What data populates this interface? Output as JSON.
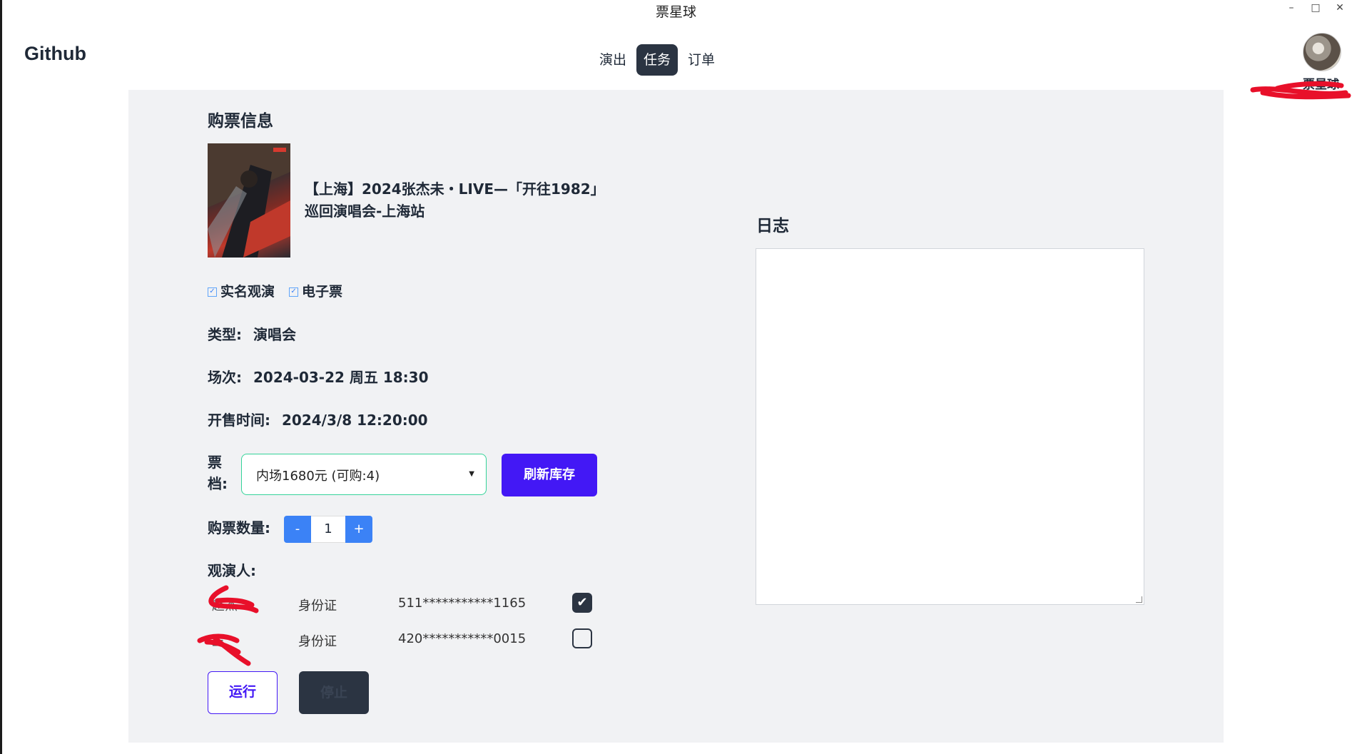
{
  "window": {
    "title": "票星球",
    "controls": {
      "minimize": "–",
      "maximize": "□",
      "close": "✕"
    }
  },
  "header": {
    "brand": "Github",
    "tabs": [
      {
        "label": "演出"
      },
      {
        "label": "任务"
      },
      {
        "label": "订单"
      }
    ],
    "active_tab": "任务",
    "user": {
      "name": "票星球"
    }
  },
  "ticket": {
    "section_title": "购票信息",
    "show_title_line1": "【上海】2024张杰未・LIVE—「开往1982」",
    "show_title_line2": "巡回演唱会-上海站",
    "tags": [
      "实名观演",
      "电子票"
    ],
    "type_label": "类型:",
    "type_value": "演唱会",
    "session_label": "场次:",
    "session_value": "2024-03-22 周五 18:30",
    "sale_label": "开售时间:",
    "sale_value": "2024/3/8 12:20:00",
    "tier_label": "票档:",
    "tier_selected": "内场1680元 (可购:4)",
    "refresh_label": "刷新库存",
    "qty_label": "购票数量:",
    "qty_minus": "-",
    "qty_value": "1",
    "qty_plus": "+",
    "audience_label": "观演人:",
    "audience": [
      {
        "name": "赵杰",
        "id_type": "身份证",
        "id_number": "511***********1165",
        "checked": true
      },
      {
        "name": "王",
        "id_type": "身份证",
        "id_number": "420***********0015",
        "checked": false
      }
    ],
    "run_label": "运行",
    "stop_label": "停止"
  },
  "log": {
    "title": "日志",
    "content": ""
  },
  "colors": {
    "accent": "#4318f5",
    "dark": "#2b3442",
    "stepper": "#3b82f6",
    "select_border": "#34d399",
    "panel": "#f1f2f4"
  }
}
